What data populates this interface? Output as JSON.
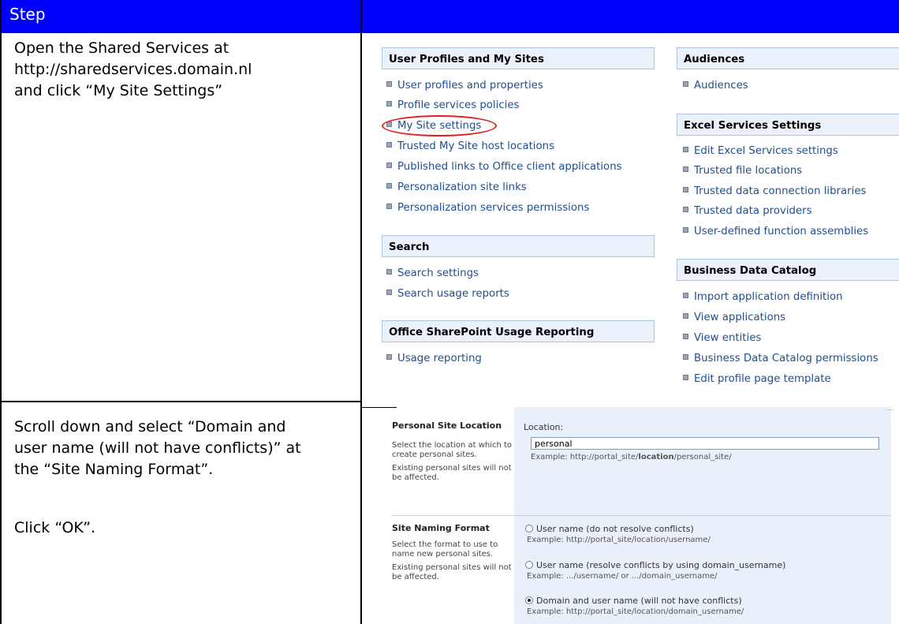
{
  "header": {
    "step_label": "Step"
  },
  "steps": [
    {
      "lines": [
        "Open the Shared Services at",
        "http://sharedservices.domain.nl",
        "and click “My Site Settings”"
      ]
    },
    {
      "lines": [
        "Scroll down and select “Domain and",
        "user name (will not have conflicts)” at",
        "the “Site Naming Format”."
      ],
      "extra": "Click “OK”."
    }
  ],
  "sharepoint": {
    "left_sections": [
      {
        "title": "User Profiles and My Sites",
        "links": [
          "User profiles and properties",
          "Profile services policies",
          "My Site settings",
          "Trusted My Site host locations",
          "Published links to Office client applications",
          "Personalization site links",
          "Personalization services permissions"
        ]
      },
      {
        "title": "Search",
        "links": [
          "Search settings",
          "Search usage reports"
        ]
      },
      {
        "title": "Office SharePoint Usage Reporting",
        "links": [
          "Usage reporting"
        ]
      }
    ],
    "right_sections": [
      {
        "title": "Audiences",
        "links": [
          "Audiences"
        ]
      },
      {
        "title": "Excel Services Settings",
        "links": [
          "Edit Excel Services settings",
          "Trusted file locations",
          "Trusted data connection libraries",
          "Trusted data providers",
          "User-defined function assemblies"
        ]
      },
      {
        "title": "Business Data Catalog",
        "links": [
          "Import application definition",
          "View applications",
          "View entities",
          "Business Data Catalog permissions",
          "Edit profile page template"
        ]
      }
    ]
  },
  "form": {
    "location": {
      "title": "Personal Site Location",
      "desc1": "Select the location at which to",
      "desc2": "create personal sites.",
      "desc3": "Existing personal sites will not",
      "desc4": "be affected.",
      "field_label": "Location:",
      "field_value": "personal",
      "example_pre": "Example: http://portal_site/",
      "example_bold": "location",
      "example_post": "/personal_site/"
    },
    "naming": {
      "title": "Site Naming Format",
      "desc1": "Select the format to use to",
      "desc2": "name new personal sites.",
      "desc3": "Existing personal sites will not",
      "desc4": "be affected.",
      "options": [
        {
          "label": "User name (do not resolve conflicts)",
          "example": "Example: http://portal_site/location/username/",
          "checked": false
        },
        {
          "label": "User name (resolve conflicts by using domain_username)",
          "example": "Example: .../username/ or .../domain_username/",
          "checked": false
        },
        {
          "label": "Domain and user name (will not have conflicts)",
          "example": "Example: http://portal_site/location/domain_username/",
          "checked": true
        }
      ]
    }
  }
}
